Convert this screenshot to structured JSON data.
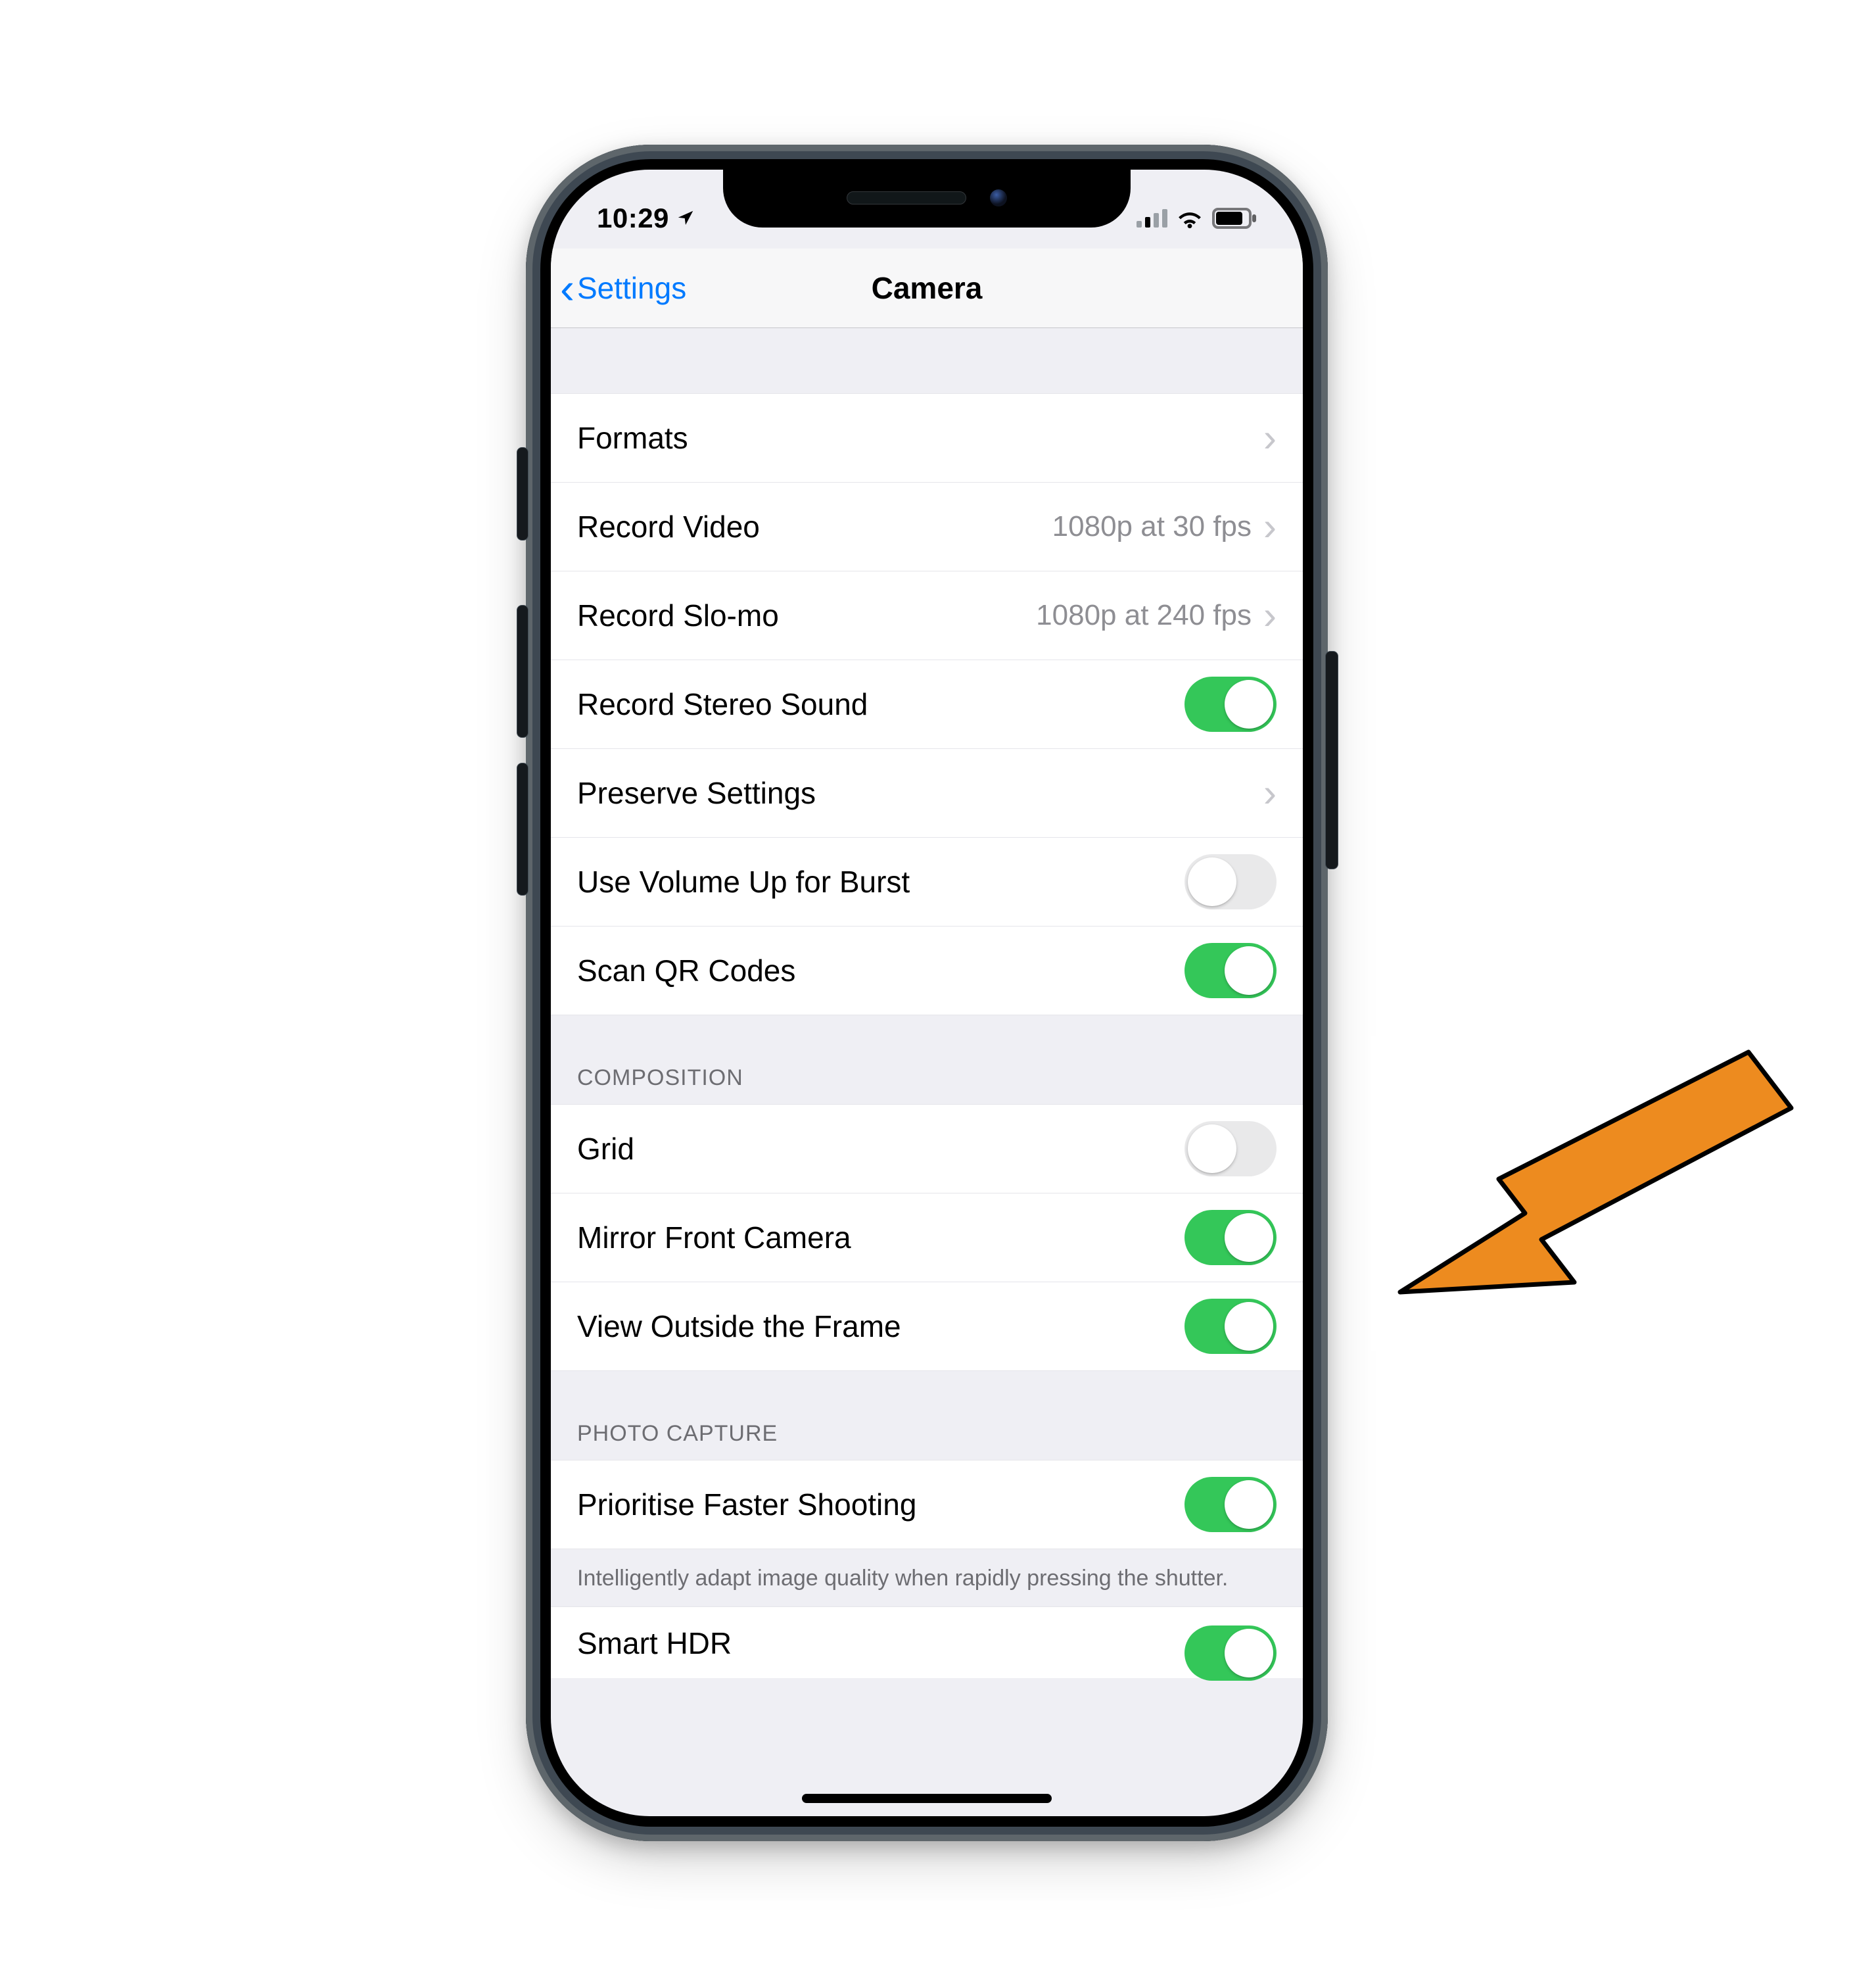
{
  "status": {
    "time": "10:29",
    "location_icon": true
  },
  "nav": {
    "back_label": "Settings",
    "title": "Camera"
  },
  "sections": {
    "general": {
      "formats_label": "Formats",
      "record_video_label": "Record Video",
      "record_video_value": "1080p at 30 fps",
      "record_slomo_label": "Record Slo-mo",
      "record_slomo_value": "1080p at 240 fps",
      "record_stereo_label": "Record Stereo Sound",
      "record_stereo_on": true,
      "preserve_label": "Preserve Settings",
      "volume_burst_label": "Use Volume Up for Burst",
      "volume_burst_on": false,
      "scan_qr_label": "Scan QR Codes",
      "scan_qr_on": true
    },
    "composition": {
      "header": "COMPOSITION",
      "grid_label": "Grid",
      "grid_on": false,
      "mirror_front_label": "Mirror Front Camera",
      "mirror_front_on": true,
      "view_outside_label": "View Outside the Frame",
      "view_outside_on": true
    },
    "photo_capture": {
      "header": "PHOTO CAPTURE",
      "prioritise_label": "Prioritise Faster Shooting",
      "prioritise_on": true,
      "prioritise_footer": "Intelligently adapt image quality when rapidly pressing the shutter.",
      "smart_hdr_label": "Smart HDR",
      "smart_hdr_on": true
    }
  },
  "colors": {
    "accent": "#007aff",
    "toggle_on": "#34c759",
    "arrow": "#ed8b1f"
  }
}
